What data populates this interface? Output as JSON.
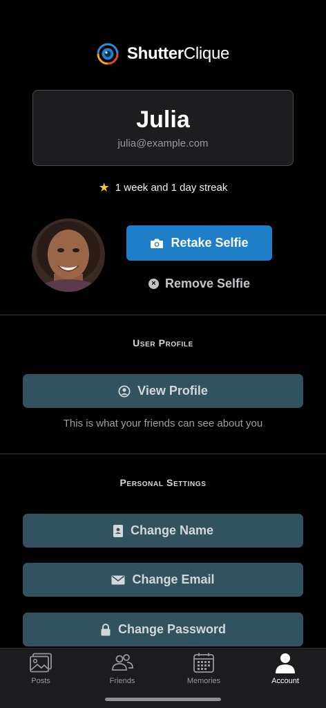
{
  "brand": {
    "bold": "Shutter",
    "light": "Clique"
  },
  "user": {
    "name": "Julia",
    "email": "julia@example.com"
  },
  "streak": {
    "text": "1 week and 1 day streak"
  },
  "selfie": {
    "retake_label": "Retake Selfie",
    "remove_label": "Remove Selfie"
  },
  "user_profile": {
    "title": "User Profile",
    "view_label": "View Profile",
    "helper": "This is what your friends can see about you"
  },
  "personal_settings": {
    "title": "Personal Settings",
    "change_name": "Change Name",
    "change_email": "Change Email",
    "change_password": "Change Password"
  },
  "tabs": [
    {
      "label": "Posts",
      "icon": "photo-icon",
      "active": false
    },
    {
      "label": "Friends",
      "icon": "people-icon",
      "active": false
    },
    {
      "label": "Memories",
      "icon": "calendar-icon",
      "active": false
    },
    {
      "label": "Account",
      "icon": "person-icon",
      "active": true
    }
  ],
  "colors": {
    "accent": "#1e7fc8",
    "slate": "#33525f",
    "star": "#f0c541"
  }
}
